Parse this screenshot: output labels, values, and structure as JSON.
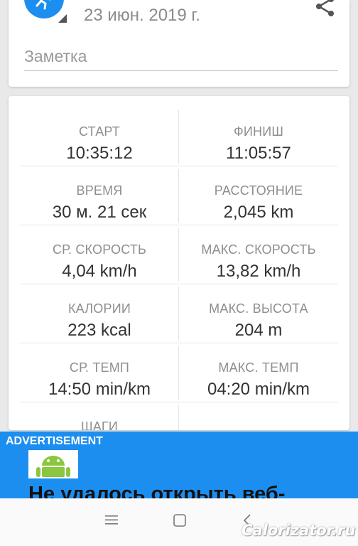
{
  "header": {
    "date": "23 июн. 2019 г.",
    "note_placeholder": "Заметка"
  },
  "stats": [
    {
      "left": {
        "label": "СТАРТ",
        "value": "10:35:12"
      },
      "right": {
        "label": "ФИНИШ",
        "value": "11:05:57"
      }
    },
    {
      "left": {
        "label": "ВРЕМЯ",
        "value": "30 м. 21 сек"
      },
      "right": {
        "label": "РАССТОЯНИЕ",
        "value": "2,045 km"
      }
    },
    {
      "left": {
        "label": "СР. СКОРОСТЬ",
        "value": "4,04 km/h"
      },
      "right": {
        "label": "МАКС. СКОРОСТЬ",
        "value": "13,82 km/h"
      }
    },
    {
      "left": {
        "label": "КАЛОРИИ",
        "value": "223 kcal"
      },
      "right": {
        "label": "МАКС. ВЫСОТА",
        "value": "204 m"
      }
    },
    {
      "left": {
        "label": "СР. ТЕМП",
        "value": "14:50 min/km"
      },
      "right": {
        "label": "МАКС. ТЕМП",
        "value": "04:20 min/km"
      }
    },
    {
      "left": {
        "label": "ШАГИ",
        "value": ""
      },
      "right": {
        "label": "",
        "value": ""
      }
    }
  ],
  "ad": {
    "label": "ADVERTISEMENT",
    "headline": "Не удалось открыть веб-"
  },
  "watermark": "Calorizator.ru",
  "icons": {
    "activity": "running-person-icon",
    "share": "share-icon",
    "nav_menu": "menu-icon",
    "nav_home": "home-square-icon",
    "nav_back": "back-chevron-icon"
  },
  "colors": {
    "accent": "#1c8ef0",
    "label": "#8e8e8e",
    "value": "#333333"
  }
}
